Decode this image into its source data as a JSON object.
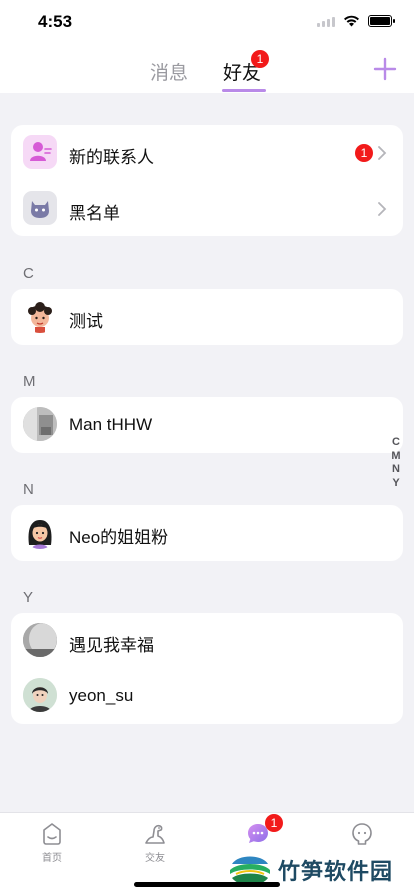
{
  "status_bar": {
    "time": "4:53"
  },
  "header": {
    "tabs": [
      {
        "label": "消息"
      },
      {
        "label": "好友"
      }
    ],
    "friends_badge": "1",
    "add_icon": "plus-icon"
  },
  "top_card": {
    "items": [
      {
        "label": "新的联系人",
        "icon": "new-contact-icon",
        "badge": "1"
      },
      {
        "label": "黑名单",
        "icon": "blacklist-icon"
      }
    ]
  },
  "sections": [
    {
      "letter": "C",
      "contacts": [
        {
          "name": "测试"
        }
      ]
    },
    {
      "letter": "M",
      "contacts": [
        {
          "name": "Man tHHW"
        }
      ]
    },
    {
      "letter": "N",
      "contacts": [
        {
          "name": "Neo的姐姐粉"
        }
      ]
    },
    {
      "letter": "Y",
      "contacts": [
        {
          "name": "遇见我幸福"
        },
        {
          "name": "yeon_su"
        }
      ]
    }
  ],
  "index_bar": [
    "C",
    "M",
    "N",
    "Y"
  ],
  "tabbar": {
    "items": [
      {
        "label": "首页",
        "icon": "home-icon"
      },
      {
        "label": "交友",
        "icon": "dinosaur-icon"
      },
      {
        "label": "",
        "icon": "chat-icon"
      },
      {
        "label": "",
        "icon": "profile-icon"
      }
    ],
    "chat_badge": "1"
  },
  "watermark": {
    "text": "竹笋软件园"
  },
  "colors": {
    "accent": "#b98ae8",
    "badge": "#f21a1a",
    "background": "#f2f2f6"
  }
}
